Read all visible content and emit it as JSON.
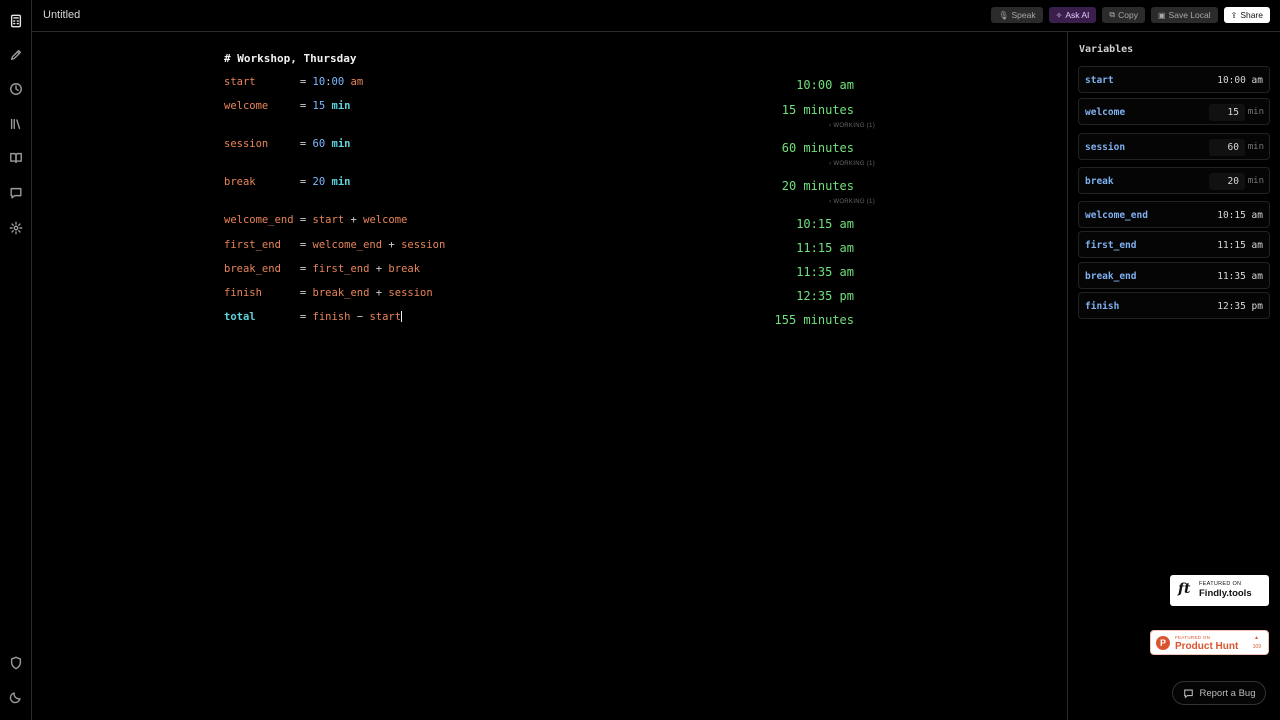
{
  "window": {
    "title": "Untitled"
  },
  "toolbar": {
    "speak": "Speak",
    "ask_ai": "Ask AI",
    "copy": "Copy",
    "save_local": "Save Local",
    "share": "Share"
  },
  "sidebar_icons": [
    "calculator-icon",
    "pencil-icon",
    "clock-icon",
    "library-icon",
    "book-icon",
    "chat-icon",
    "settings-icon",
    "shield-icon",
    "moon-icon"
  ],
  "editor": {
    "heading": "# Workshop, Thursday",
    "lines": [
      {
        "var": "start      ",
        "num": "10",
        "colon": ":",
        "num2": "00",
        "suffix": " am",
        "result": "10:00 am"
      },
      {
        "var": "welcome    ",
        "num": "15",
        "unit": "min",
        "result": "15 minutes",
        "hint": "› WORKING (1)"
      },
      {
        "var": "session    ",
        "num": "60",
        "unit": "min",
        "result": "60 minutes",
        "hint": "› WORKING (1)"
      },
      {
        "var": "break      ",
        "num": "20",
        "unit": "min",
        "result": "20 minutes",
        "hint": "› WORKING (1)"
      },
      {
        "var": "welcome_end",
        "a": "start",
        "op": "+",
        "b": "welcome",
        "result": "10:15 am"
      },
      {
        "var": "first_end  ",
        "a": "welcome_end",
        "op": "+",
        "b": "session",
        "result": "11:15 am"
      },
      {
        "var": "break_end  ",
        "a": "first_end",
        "op": "+",
        "b": "break",
        "result": "11:35 am"
      },
      {
        "var": "finish     ",
        "a": "break_end",
        "op": "+",
        "b": "session",
        "result": "12:35 pm"
      },
      {
        "var": "total      ",
        "a": "finish",
        "op": "−",
        "b": "start",
        "result": "155 minutes"
      }
    ]
  },
  "variables": {
    "title": "Variables",
    "items": [
      {
        "name": "start",
        "value": "10:00 am"
      },
      {
        "name": "welcome",
        "input": "15",
        "unit": "min"
      },
      {
        "name": "session",
        "input": "60",
        "unit": "min"
      },
      {
        "name": "break",
        "input": "20",
        "unit": "min"
      },
      {
        "name": "welcome_end",
        "value": "10:15 am"
      },
      {
        "name": "first_end",
        "value": "11:15 am"
      },
      {
        "name": "break_end",
        "value": "11:35 am"
      },
      {
        "name": "finish",
        "value": "12:35 pm"
      }
    ]
  },
  "badges": {
    "findly": {
      "logo": "ft",
      "small": "FEATURED ON",
      "big": "Findly.tools"
    },
    "producthunt": {
      "logo": "P",
      "small": "FEATURED ON",
      "big": "Product Hunt",
      "arrow": "▲",
      "count": "109"
    }
  },
  "report_bug": "Report a Bug",
  "colors": {
    "result": "#6fe07a",
    "variable": "#e8845a",
    "unit": "#5fd3dc",
    "number": "#7fb7ff",
    "ai": "#3a1f4d"
  }
}
